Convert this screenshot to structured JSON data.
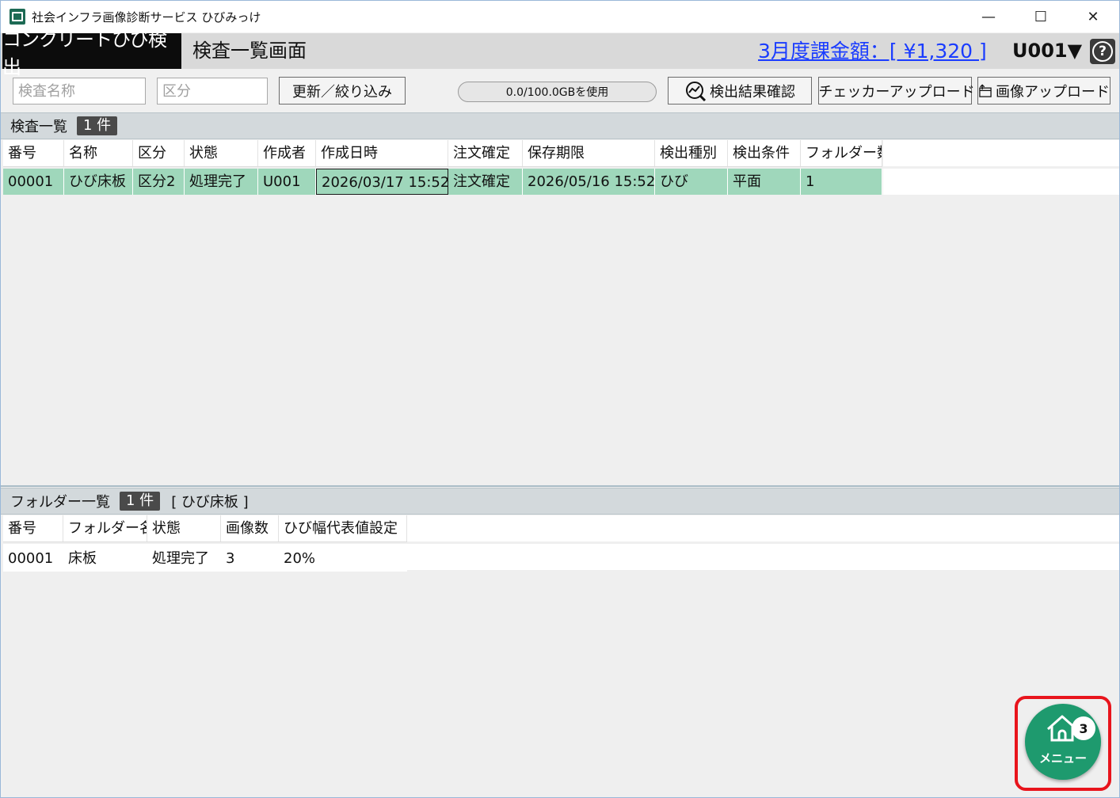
{
  "window": {
    "title": "社会インフラ画像診断サービス ひびみっけ",
    "minimize": "—",
    "maximize": "☐",
    "close": "✕"
  },
  "header": {
    "app_name": "コンクリートひび検出",
    "screen_name": "検査一覧画面",
    "billing": "3月度課金額：[ ¥1,320 ]",
    "user": "U001▼",
    "help": "?"
  },
  "toolbar": {
    "name_placeholder": "検査名称",
    "category_placeholder": "区分",
    "refresh_label": "更新／絞り込み",
    "storage_text": "0.0/100.0GBを使用",
    "storage_used_fraction": 0.0,
    "result_check_label": "検出結果確認",
    "checker_upload_label": "チェッカーアップロード",
    "image_upload_label": "画像アップロード"
  },
  "inspections": {
    "title": "検査一覧",
    "count": "1 件",
    "columns": [
      "番号",
      "名称",
      "区分",
      "状態",
      "作成者",
      "作成日時",
      "注文確定",
      "保存期限",
      "検出種別",
      "検出条件",
      "フォルダー数"
    ],
    "rows": [
      [
        "00001",
        "ひび床板",
        "区分2",
        "処理完了",
        "U001",
        "2026/03/17 15:52",
        "注文確定",
        "2026/05/16 15:52",
        "ひび",
        "平面",
        "1"
      ]
    ]
  },
  "folders": {
    "title": "フォルダー一覧",
    "count": "1 件",
    "target": "[ ひび床板 ]",
    "columns": [
      "番号",
      "フォルダー名",
      "状態",
      "画像数",
      "ひび幅代表値設定"
    ],
    "rows": [
      [
        "00001",
        "床板",
        "処理完了",
        "3",
        "20%"
      ]
    ]
  },
  "menu": {
    "label": "メニュー",
    "badge": "3"
  }
}
